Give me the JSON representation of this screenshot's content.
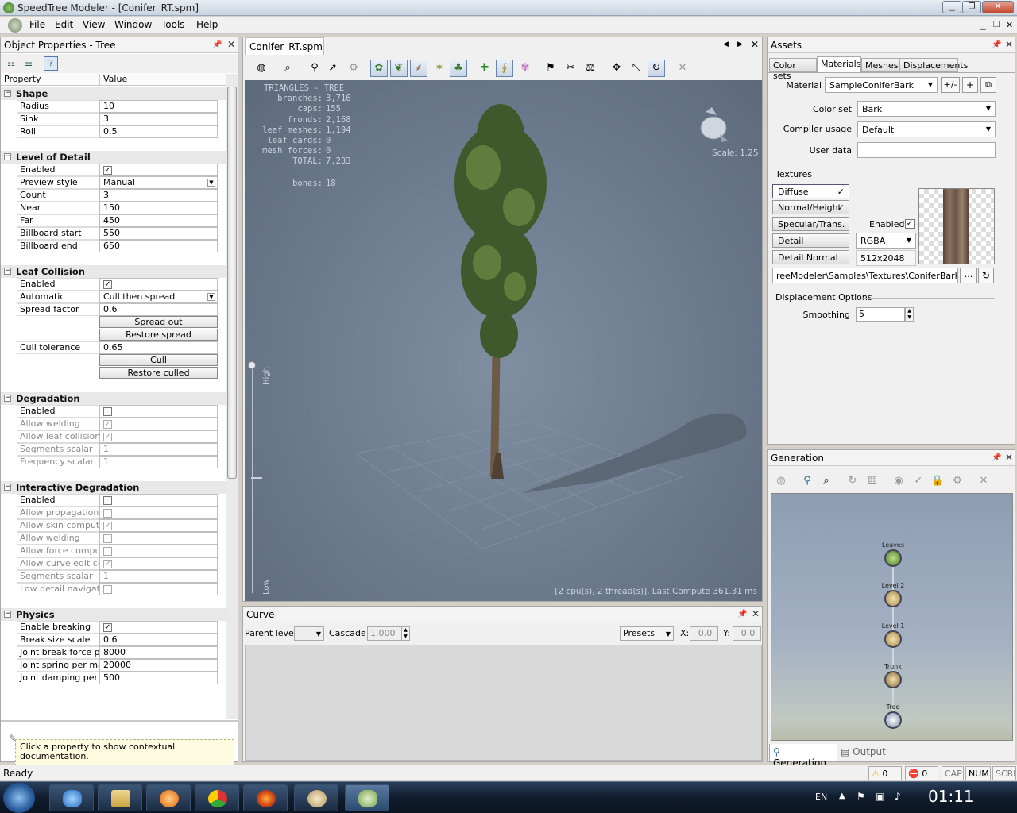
{
  "window": {
    "title": "SpeedTree Modeler - [Conifer_RT.spm]"
  },
  "menu": [
    "File",
    "Edit",
    "View",
    "Window",
    "Tools",
    "Help"
  ],
  "props_panel": {
    "title": "Object Properties - Tree",
    "col_property": "Property",
    "col_value": "Value",
    "doc_hint": "Click a property to show contextual documentation."
  },
  "categories": {
    "shape": "Shape",
    "lod": "Level of Detail",
    "leaf": "Leaf Collision",
    "degr": "Degradation",
    "idegr": "Interactive Degradation",
    "phys": "Physics"
  },
  "rows": {
    "radius": [
      "Radius",
      "10"
    ],
    "sink": [
      "Sink",
      "3"
    ],
    "roll": [
      "Roll",
      "0.5"
    ],
    "lod_enabled": [
      "Enabled",
      ""
    ],
    "preview": [
      "Preview style",
      "Manual"
    ],
    "count": [
      "Count",
      "3"
    ],
    "near": [
      "Near",
      "150"
    ],
    "far": [
      "Far",
      "450"
    ],
    "bb_start": [
      "Billboard start",
      "550"
    ],
    "bb_end": [
      "Billboard end",
      "650"
    ],
    "lc_enabled": [
      "Enabled",
      ""
    ],
    "automatic": [
      "Automatic",
      "Cull then spread"
    ],
    "spread": [
      "Spread factor",
      "0.6"
    ],
    "cull_tol": [
      "Cull tolerance",
      "0.65"
    ],
    "d_enabled": [
      "Enabled",
      ""
    ],
    "d_weld": [
      "Allow welding",
      ""
    ],
    "d_leafcol": [
      "Allow leaf collision",
      ""
    ],
    "d_seg": [
      "Segments scalar",
      "1"
    ],
    "d_freq": [
      "Frequency scalar",
      "1"
    ],
    "i_enabled": [
      "Enabled",
      ""
    ],
    "i_prop": [
      "Allow propagation",
      ""
    ],
    "i_skin": [
      "Allow skin compute",
      ""
    ],
    "i_weld": [
      "Allow welding",
      ""
    ],
    "i_force": [
      "Allow force compute",
      ""
    ],
    "i_curve": [
      "Allow curve edit co...",
      ""
    ],
    "i_seg": [
      "Segments scalar",
      "1"
    ],
    "i_low": [
      "Low detail navigation",
      ""
    ],
    "p_break": [
      "Enable breaking",
      ""
    ],
    "p_bsize": [
      "Break size scale",
      "0.6"
    ],
    "p_jbf": [
      "Joint break force p...",
      "8000"
    ],
    "p_jsp": [
      "Joint spring per mass",
      "20000"
    ],
    "p_jdp": [
      "Joint damping per ...",
      "500"
    ]
  },
  "buttons": {
    "spread_out": "Spread out",
    "restore_spread": "Restore spread",
    "cull": "Cull",
    "restore_culled": "Restore culled"
  },
  "document": {
    "tab": "Conifer_RT.spm",
    "stats_title": "TRIANGLES - TREE",
    "stats": [
      [
        "branches:",
        "3,716"
      ],
      [
        "caps:",
        "155"
      ],
      [
        "fronds:",
        "2,168"
      ],
      [
        "leaf meshes:",
        "1,194"
      ],
      [
        "leaf cards:",
        "0"
      ],
      [
        "mesh forces:",
        "0"
      ],
      [
        "TOTAL:",
        "7,233"
      ]
    ],
    "bones_label": "bones:",
    "bones": "18",
    "scale": "Scale: 1.25",
    "high": "High",
    "low": "Low",
    "compute": "[2 cpu(s), 2 thread(s)], Last Compute 361.31 ms"
  },
  "curve": {
    "title": "Curve",
    "parent_level": "Parent level:",
    "cascade": "Cascade:",
    "cascade_val": "1.000",
    "presets": "Presets",
    "x_label": "X:",
    "x_val": "0.0",
    "y_label": "Y:",
    "y_val": "0.0"
  },
  "assets": {
    "title": "Assets",
    "tabs": [
      "Color sets",
      "Materials",
      "Meshes",
      "Displacements"
    ],
    "material_label": "Material",
    "material": "SampleConiferBark",
    "btn_pm": "+/-",
    "btn_plus": "+",
    "colorset_label": "Color set",
    "colorset": "Bark",
    "compiler_label": "Compiler usage",
    "compiler": "Default",
    "userdata_label": "User data",
    "textures_label": "Textures",
    "tex": [
      "Diffuse",
      "Normal/Height",
      "Specular/Trans.",
      "Detail",
      "Detail Normal"
    ],
    "enabled": "Enabled",
    "format": "RGBA",
    "size": "512x2048",
    "path": "reeModeler\\Samples\\Textures\\ConiferBark.tga",
    "path_btn": "...",
    "disp_label": "Displacement Options",
    "smoothing_label": "Smoothing",
    "smoothing": "5"
  },
  "generation": {
    "title": "Generation",
    "nodes": [
      "Leaves",
      "Level 2",
      "Level 1",
      "Trunk",
      "Tree"
    ],
    "tab_gen": "Generation",
    "tab_out": "Output"
  },
  "status": {
    "ready": "Ready",
    "warn": "0",
    "err": "0",
    "cap": "CAP",
    "num": "NUM",
    "scrl": "SCRL"
  },
  "taskbar": {
    "lang": "EN",
    "clock": "01:11"
  },
  "colors": {
    "accent": "#5577aa",
    "viewport": "#6e7d90"
  }
}
